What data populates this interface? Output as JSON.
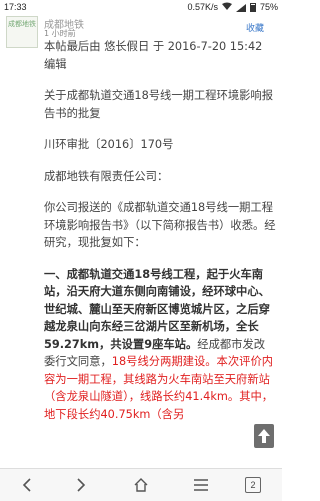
{
  "status_bar": {
    "time": "17:33",
    "network_speed": "0.57K/s",
    "battery": "75%"
  },
  "header": {
    "author": "成都地铁",
    "time_ago": "1 小时前",
    "favorite_label": "收藏",
    "avatar_text": "成都地铁"
  },
  "post": {
    "edited_note": "本帖最后由 悠长假日 于 2016-7-20 15:42 编辑",
    "title": "关于成都轨道交通18号线一期工程环境影响报告书的批复",
    "doc_number": "川环审批〔2016〕170号",
    "addressee": "成都地铁有限责任公司：",
    "intro": "你公司报送的《成都轨道交通18号线一期工程环境影响报告书》（以下简称报告书）收悉。经研究，现批复如下：",
    "section1_bold": "一、成都轨道交通18号线工程，起于火车南站，沿天府大道东侧向南铺设，经环球中心、世纪城、麓山至天府新区博览城片区，之后穿越龙泉山向东经三岔湖片区至新机场，全长59.27km，共设置9座车站。",
    "section1_normal": "经成都市发改委行文同意，",
    "section1_red": "18号线分两期建设。本次评价内容为一期工程，其线路为火车南站至天府新站（含龙泉山隧道），线路长约41.4km。其中，地下段长约40.75km（含另"
  },
  "bottom_bar": {
    "tab_count": "2"
  }
}
